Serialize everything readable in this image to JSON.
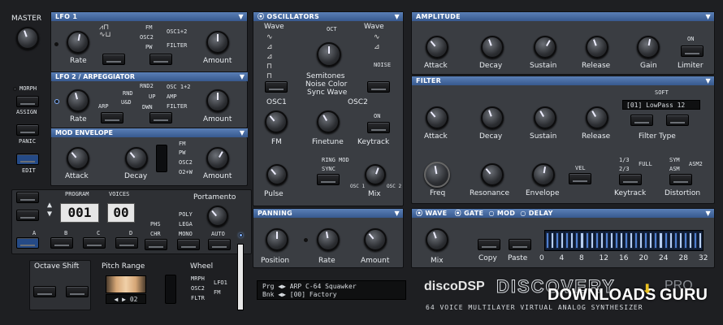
{
  "left": {
    "master": "MASTER",
    "morph": "MORPH",
    "assign": "ASSIGN",
    "panic": "PANIC",
    "edit": "EDIT",
    "program": "PROGRAM",
    "voices": "VOICES",
    "program_val": "001",
    "voices_val": "00",
    "slots": [
      "A",
      "B",
      "C",
      "D"
    ],
    "phs": "PHS",
    "chr": "CHR",
    "poly": "POLY",
    "lega": "LEGA",
    "mono": "MONO",
    "auto": "AUTO",
    "portamento": "Portamento",
    "octave_shift": "Octave Shift",
    "pitch_range": "Pitch Range",
    "pitch_val": "02",
    "wheel": "Wheel",
    "wheel_opts": [
      "MRPH",
      "OSC2",
      "FLTR"
    ],
    "lfo1": "LFO1",
    "fm": "FM"
  },
  "lfo1": {
    "title": "LFO 1",
    "rate": "Rate",
    "amount": "Amount",
    "targets": [
      "FM",
      "OSC2",
      "PW"
    ],
    "t2": [
      "OSC1+2",
      "FILTER"
    ]
  },
  "lfo2": {
    "title": "LFO 2 / ARPEGGIATOR",
    "rate": "Rate",
    "amount": "Amount",
    "arp": "ARP",
    "modes": [
      "RND2",
      "RND",
      "U&D",
      "UP",
      "DWN"
    ],
    "targets": [
      "OSC 1+2",
      "AMP",
      "FILTER"
    ]
  },
  "modenv": {
    "title": "MOD ENVELOPE",
    "attack": "Attack",
    "decay": "Decay",
    "amount": "Amount",
    "targets": [
      "FM",
      "PW",
      "OSC2",
      "O2+W"
    ]
  },
  "osc": {
    "title": "OSCILLATORS",
    "wave": "Wave",
    "oct": "OCT",
    "semitones": "Semitones",
    "noise_color": "Noise Color",
    "sync_wave": "Sync Wave",
    "osc1": "OSC1",
    "osc2": "OSC2",
    "noise": "NOISE",
    "fm": "FM",
    "finetune": "Finetune",
    "keytrack": "Keytrack",
    "on": "ON",
    "ring_mod": "RING MOD",
    "sync": "SYNC",
    "pulse": "Pulse",
    "mix": "Mix",
    "osc1_short": "OSC 1",
    "osc2_short": "OSC 2"
  },
  "amp": {
    "title": "AMPLITUDE",
    "attack": "Attack",
    "decay": "Decay",
    "sustain": "Sustain",
    "release": "Release",
    "gain": "Gain",
    "on": "ON",
    "limiter": "Limiter"
  },
  "filter": {
    "title": "FILTER",
    "soft": "SOFT",
    "type_val": "[01] LowPass 12",
    "filter_type": "Filter Type",
    "attack": "Attack",
    "decay": "Decay",
    "sustain": "Sustain",
    "release": "Release",
    "freq": "Freq",
    "resonance": "Resonance",
    "envelope": "Envelope",
    "vel": "VEL",
    "keytrack": "Keytrack",
    "kt_opts": [
      "1/3",
      "2/3"
    ],
    "full": "FULL",
    "distortion": "Distortion",
    "sym": "SYM",
    "asm": "ASM",
    "asm2": "ASM2"
  },
  "panning": {
    "title": "PANNING",
    "position": "Position",
    "rate": "Rate",
    "amount": "Amount"
  },
  "seq": {
    "tabs": [
      "WAVE",
      "GATE",
      "MOD",
      "DELAY"
    ],
    "mix": "Mix",
    "copy": "Copy",
    "paste": "Paste",
    "steps": [
      "0",
      "4",
      "8",
      "12",
      "16",
      "20",
      "24",
      "28",
      "32"
    ]
  },
  "display": {
    "prg_label": "Prg",
    "prg_val": "ARP C-64 Squawker",
    "bnk_label": "Bnk",
    "bnk_val": "[00] Factory"
  },
  "brand": {
    "discodsp": "discoDSP",
    "discovery": "DISCOVERY",
    "pro": "PRO",
    "tagline": "64 VOICE MULTILAYER VIRTUAL ANALOG SYNTHESIZER",
    "watermark": "DOWNLOADS",
    "watermark2": "GURU"
  }
}
